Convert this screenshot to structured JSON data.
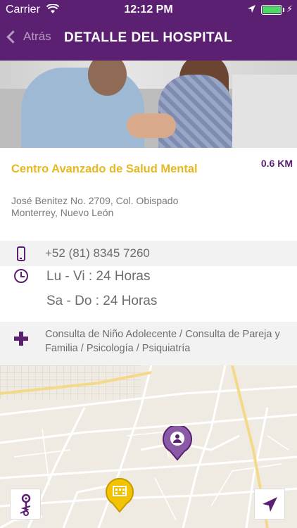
{
  "status_bar": {
    "carrier": "Carrier",
    "time": "12:12 PM",
    "battery_level": 1.0
  },
  "nav": {
    "back_label": "Atrás",
    "title": "DETALLE DEL HOSPITAL"
  },
  "hospital": {
    "name": "Centro Avanzado de Salud Mental",
    "distance": "0.6 KM",
    "address_line1": "José Benitez No. 2709, Col. Obispado",
    "address_line2": "Monterrey, Nuevo León",
    "phone": "+52 (81) 8345 7260",
    "hours_weekdays": "Lu - Vi : 24 Horas",
    "hours_weekend": "Sa - Do : 24 Horas",
    "services": "Consulta de Niño Adolecente / Consulta de Pareja y Familia / Psicología / Psiquiatría"
  },
  "icons": {
    "phone": "phone-icon",
    "hours": "clock-icon",
    "services": "plus-icon",
    "user_pin": "user-location-pin-icon",
    "hospital_pin": "hospital-pin-icon",
    "route": "route-icon",
    "navigate": "navigation-arrow-icon"
  },
  "colors": {
    "brand_purple": "#5b2072",
    "accent_yellow": "#e8b820"
  }
}
